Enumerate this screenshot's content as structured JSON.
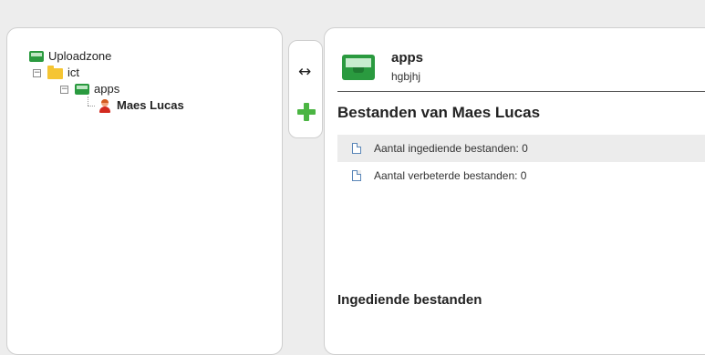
{
  "tree": {
    "root_label": "Uploadzone",
    "folder_label": "ict",
    "app_label": "apps",
    "user_label": "Maes Lucas"
  },
  "side_tabs": [
    {
      "icon": "swap-arrows-icon"
    },
    {
      "icon": "plus-icon"
    }
  ],
  "main": {
    "header_title": "apps",
    "header_subtitle": "hgbjhj",
    "section_title": "Bestanden van Maes Lucas",
    "rows": [
      {
        "label": "Aantal ingediende bestanden: 0"
      },
      {
        "label": "Aantal verbeterde bestanden: 0"
      }
    ],
    "section2_title": "Ingediende bestanden"
  },
  "colors": {
    "accent_green": "#2a9a3f",
    "folder_yellow": "#f5c533",
    "plus_green": "#4bb543"
  }
}
